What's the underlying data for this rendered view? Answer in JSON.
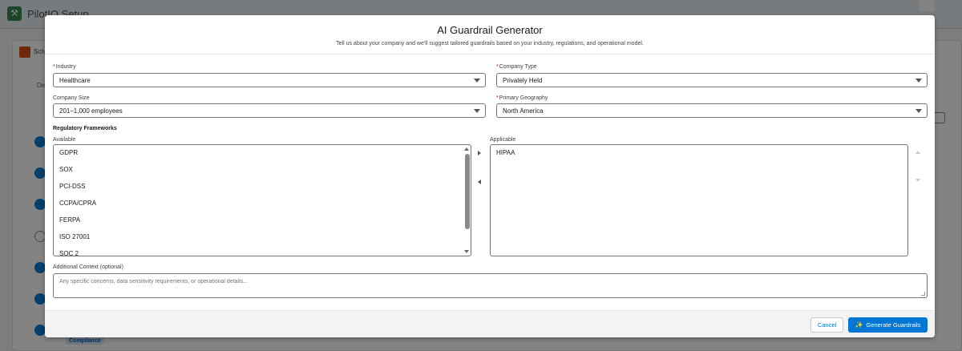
{
  "app": {
    "title": "PilotIQ Setup",
    "tab_label": "Sch",
    "side_label": "De",
    "badge": "Compliance"
  },
  "modal": {
    "title": "AI Guardrail Generator",
    "subtitle": "Tell us about your company and we'll suggest tailored guardrails based on your industry, regulations, and operational model."
  },
  "fields": {
    "industry": {
      "label": "Industry",
      "required_mark": "*",
      "value": "Healthcare"
    },
    "company_type": {
      "label": "Company Type",
      "required_mark": "*",
      "value": "Privately Held"
    },
    "company_size": {
      "label": "Company Size",
      "value": "201–1,000 employees"
    },
    "primary_geography": {
      "label": "Primary Geography",
      "required_mark": "*",
      "value": "North America"
    }
  },
  "regulatory": {
    "title": "Regulatory Frameworks",
    "available_label": "Available",
    "applicable_label": "Applicable",
    "available": [
      "GDPR",
      "SOX",
      "PCI-DSS",
      "CCPA/CPRA",
      "FERPA",
      "ISO 27001",
      "SOC 2"
    ],
    "applicable": [
      "HIPAA"
    ]
  },
  "context": {
    "label": "Additional Context (optional)",
    "placeholder": "Any specific concerns, data sensitivity requirements, or operational details..."
  },
  "footer": {
    "cancel_label": "Cancel",
    "generate_label": "Generate Guardrails"
  },
  "colors": {
    "brand": "#0176d3",
    "required": "#ba0517"
  }
}
